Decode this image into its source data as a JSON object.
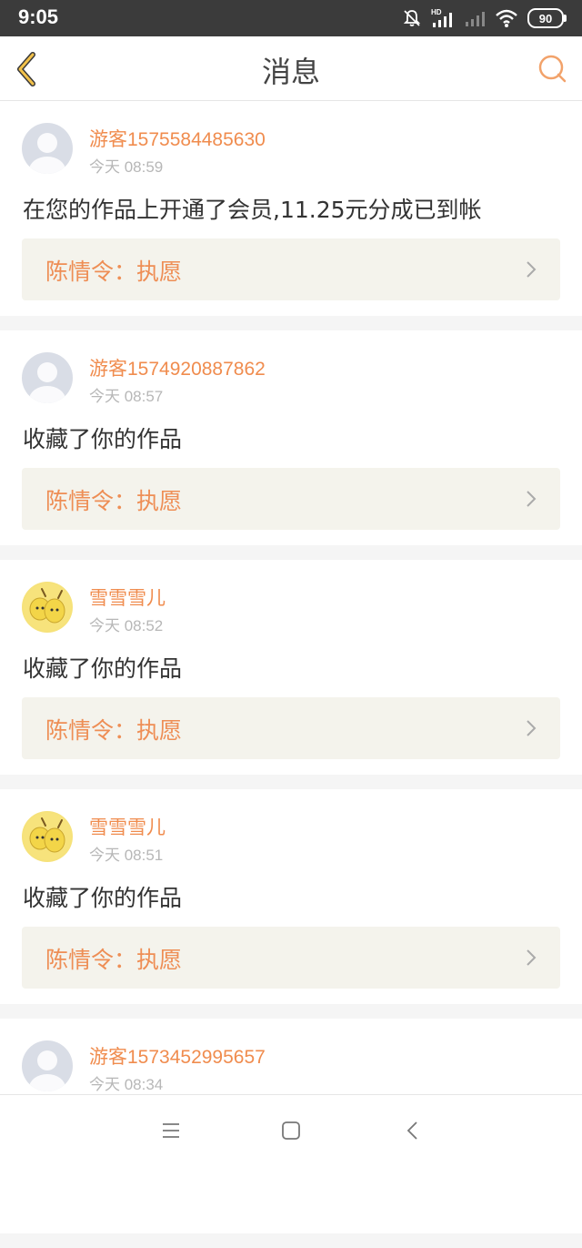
{
  "status_bar": {
    "time": "9:05",
    "battery": "90",
    "icons": [
      "bell-off-icon",
      "hd-signal-icon",
      "signal-icon",
      "wifi-icon",
      "battery-icon"
    ]
  },
  "header": {
    "title": "消息",
    "back_icon": "chevron-left-icon",
    "search_icon": "search-icon"
  },
  "colors": {
    "accent": "#f08c4e",
    "back_arrow": "#f2c14a",
    "work_bg": "#f4f3ec"
  },
  "messages": [
    {
      "username": "游客1575584485630",
      "time": "今天 08:59",
      "text": "在您的作品上开通了会员,11.25元分成已到帐",
      "work_title": "陈情令：执愿",
      "avatar": "default-avatar"
    },
    {
      "username": "游客1574920887862",
      "time": "今天 08:57",
      "text": "收藏了你的作品",
      "work_title": "陈情令：执愿",
      "avatar": "default-avatar"
    },
    {
      "username": "雪雪雪儿",
      "time": "今天 08:52",
      "text": "收藏了你的作品",
      "work_title": "陈情令：执愿",
      "avatar": "yellow-avatar"
    },
    {
      "username": "雪雪雪儿",
      "time": "今天 08:51",
      "text": "收藏了你的作品",
      "work_title": "陈情令：执愿",
      "avatar": "yellow-avatar"
    },
    {
      "username": "游客1573452995657",
      "time": "今天 08:34",
      "text": "",
      "work_title": "",
      "avatar": "default-avatar"
    }
  ],
  "nav_bar": [
    "menu-icon",
    "home-icon",
    "back-icon"
  ]
}
